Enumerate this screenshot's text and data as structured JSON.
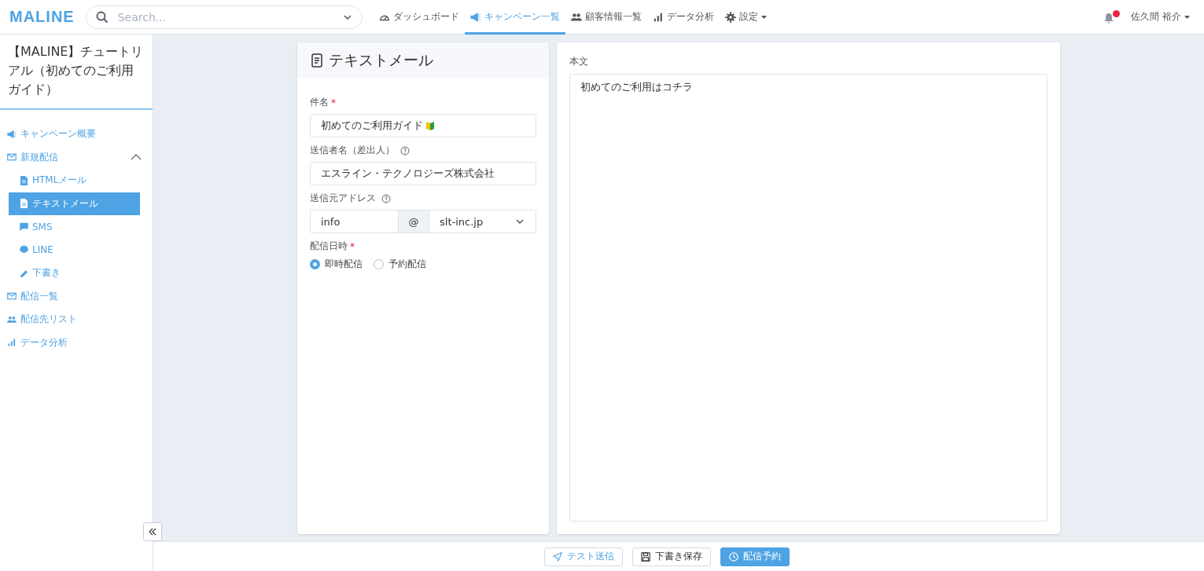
{
  "header": {
    "logo": "MALINE",
    "search": {
      "placeholder": "Search..."
    },
    "nav": [
      {
        "label": "ダッシュボード",
        "selected": false
      },
      {
        "label": "キャンペーン一覧",
        "selected": true
      },
      {
        "label": "顧客情報一覧",
        "selected": false
      },
      {
        "label": "データ分析",
        "selected": false
      },
      {
        "label": "設定",
        "selected": false
      }
    ],
    "notification": {
      "unread": true
    },
    "user": "佐久間 裕介"
  },
  "sidebar": {
    "title": "【MALINE】チュートリアル（初めてのご利用ガイド）",
    "items": [
      {
        "label": "キャンペーン概要",
        "selected": false
      },
      {
        "label": "新規配信",
        "selected": false,
        "expanded": true,
        "children": [
          {
            "label": "HTMLメール",
            "selected": false
          },
          {
            "label": "テキストメール",
            "selected": true
          },
          {
            "label": "SMS",
            "selected": false
          },
          {
            "label": "LINE",
            "selected": false
          },
          {
            "label": "下書き",
            "selected": false
          }
        ]
      },
      {
        "label": "配信一覧",
        "selected": false
      },
      {
        "label": "配信先リスト",
        "selected": false
      },
      {
        "label": "データ分析",
        "selected": false
      }
    ]
  },
  "form": {
    "title": "テキストメール",
    "subject": {
      "label": "件名",
      "required_mark": "*",
      "value": "初めてのご利用ガイド"
    },
    "sender": {
      "label": "送信者名（差出人）",
      "value": "エスライン・テクノロジーズ株式会社"
    },
    "address": {
      "label": "送信元アドレス",
      "local": "info",
      "at": "@",
      "domain": "slt-inc.jp"
    },
    "schedule": {
      "label": "配信日時",
      "required_mark": "*",
      "options": [
        {
          "label": "即時配信",
          "selected": true
        },
        {
          "label": "予約配信",
          "selected": false
        }
      ]
    }
  },
  "body": {
    "label": "本文",
    "value": "初めてのご利用はコチラ"
  },
  "actions": [
    {
      "label": "テスト送信",
      "kind": "outline"
    },
    {
      "label": "下書き保存",
      "kind": "plain"
    },
    {
      "label": "配信予約",
      "kind": "primary"
    }
  ]
}
